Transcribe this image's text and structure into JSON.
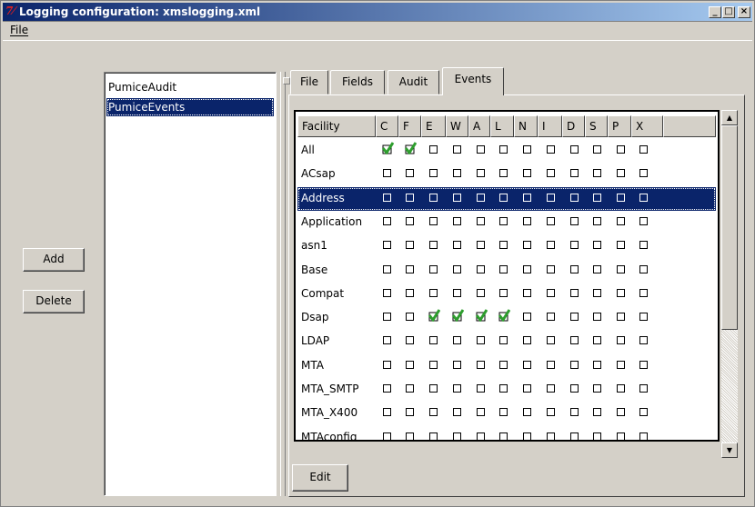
{
  "window": {
    "title": "Logging configuration: xmslogging.xml",
    "app_icon_text": "7⁄"
  },
  "titlebar_buttons": {
    "minimize": "_",
    "maximize": "□",
    "close": "×"
  },
  "menu": {
    "file": "File"
  },
  "left": {
    "add_label": "Add",
    "delete_label": "Delete"
  },
  "list": {
    "items": [
      "PumiceAudit",
      "PumiceEvents"
    ],
    "selected_index": 1
  },
  "tabs": [
    {
      "label": "File",
      "active": false
    },
    {
      "label": "Fields",
      "active": false
    },
    {
      "label": "Audit",
      "active": false
    },
    {
      "label": "Events",
      "active": true
    }
  ],
  "grid": {
    "columns": [
      "Facility",
      "C",
      "F",
      "E",
      "W",
      "A",
      "L",
      "N",
      "I",
      "D",
      "S",
      "P",
      "X"
    ],
    "rows": [
      {
        "facility": "All",
        "checked": [
          true,
          true,
          false,
          false,
          false,
          false,
          false,
          false,
          false,
          false,
          false,
          false
        ]
      },
      {
        "facility": "ACsap",
        "checked": [
          false,
          false,
          false,
          false,
          false,
          false,
          false,
          false,
          false,
          false,
          false,
          false
        ]
      },
      {
        "facility": "Address",
        "checked": [
          false,
          false,
          false,
          false,
          false,
          false,
          false,
          false,
          false,
          false,
          false,
          false
        ],
        "selected": true
      },
      {
        "facility": "Application",
        "checked": [
          false,
          false,
          false,
          false,
          false,
          false,
          false,
          false,
          false,
          false,
          false,
          false
        ]
      },
      {
        "facility": "asn1",
        "checked": [
          false,
          false,
          false,
          false,
          false,
          false,
          false,
          false,
          false,
          false,
          false,
          false
        ]
      },
      {
        "facility": "Base",
        "checked": [
          false,
          false,
          false,
          false,
          false,
          false,
          false,
          false,
          false,
          false,
          false,
          false
        ]
      },
      {
        "facility": "Compat",
        "checked": [
          false,
          false,
          false,
          false,
          false,
          false,
          false,
          false,
          false,
          false,
          false,
          false
        ]
      },
      {
        "facility": "Dsap",
        "checked": [
          false,
          false,
          true,
          true,
          true,
          true,
          false,
          false,
          false,
          false,
          false,
          false
        ]
      },
      {
        "facility": "LDAP",
        "checked": [
          false,
          false,
          false,
          false,
          false,
          false,
          false,
          false,
          false,
          false,
          false,
          false
        ]
      },
      {
        "facility": "MTA",
        "checked": [
          false,
          false,
          false,
          false,
          false,
          false,
          false,
          false,
          false,
          false,
          false,
          false
        ]
      },
      {
        "facility": "MTA_SMTP",
        "checked": [
          false,
          false,
          false,
          false,
          false,
          false,
          false,
          false,
          false,
          false,
          false,
          false
        ]
      },
      {
        "facility": "MTA_X400",
        "checked": [
          false,
          false,
          false,
          false,
          false,
          false,
          false,
          false,
          false,
          false,
          false,
          false
        ]
      },
      {
        "facility": "MTAconfig",
        "checked": [
          false,
          false,
          false,
          false,
          false,
          false,
          false,
          false,
          false,
          false,
          false,
          false
        ]
      }
    ]
  },
  "edit": {
    "label": "Edit"
  },
  "scrollbar": {
    "up": "▲",
    "down": "▼"
  },
  "colors": {
    "selection": "#0a246a",
    "check_green": "#2e9e2e"
  }
}
